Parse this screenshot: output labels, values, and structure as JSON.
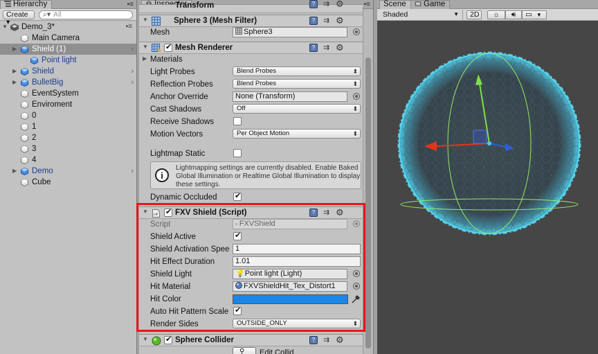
{
  "hierarchy": {
    "tab_label": "Hierarchy",
    "create_label": "Create",
    "search_placeholder": "All",
    "scene_name": "Demo_3*",
    "items": [
      {
        "label": "Main Camera",
        "style": "normal",
        "has_children": false,
        "selected": false
      },
      {
        "label": "Shield (1)",
        "style": "blue",
        "has_children": true,
        "selected": true
      },
      {
        "label": "Point light",
        "style": "blue",
        "has_children": false,
        "selected": false
      },
      {
        "label": "Shield",
        "style": "blue",
        "has_children": true,
        "selected": false
      },
      {
        "label": "BulletBig",
        "style": "blue",
        "has_children": true,
        "selected": false
      },
      {
        "label": "EventSystem",
        "style": "normal",
        "has_children": false,
        "selected": false
      },
      {
        "label": "Enviroment",
        "style": "normal",
        "has_children": false,
        "selected": false
      },
      {
        "label": "0",
        "style": "normal",
        "has_children": false,
        "selected": false
      },
      {
        "label": "1",
        "style": "normal",
        "has_children": false,
        "selected": false
      },
      {
        "label": "2",
        "style": "normal",
        "has_children": false,
        "selected": false
      },
      {
        "label": "3",
        "style": "normal",
        "has_children": false,
        "selected": false
      },
      {
        "label": "4",
        "style": "normal",
        "has_children": false,
        "selected": false
      },
      {
        "label": "Demo",
        "style": "blue",
        "has_children": true,
        "selected": false
      },
      {
        "label": "Cube",
        "style": "normal",
        "has_children": false,
        "selected": false
      }
    ]
  },
  "inspector": {
    "tab_label": "Inspector",
    "transform_label": "Transform",
    "mesh_filter": {
      "title": "Sphere 3 (Mesh Filter)",
      "mesh_label": "Mesh",
      "mesh_value": "Sphere3"
    },
    "mesh_renderer": {
      "title": "Mesh Renderer",
      "enabled": true,
      "materials_label": "Materials",
      "light_probes_label": "Light Probes",
      "light_probes_value": "Blend Probes",
      "reflection_probes_label": "Reflection Probes",
      "reflection_probes_value": "Blend Probes",
      "anchor_override_label": "Anchor Override",
      "anchor_override_value": "None (Transform)",
      "cast_shadows_label": "Cast Shadows",
      "cast_shadows_value": "Off",
      "receive_shadows_label": "Receive Shadows",
      "receive_shadows_checked": false,
      "motion_vectors_label": "Motion Vectors",
      "motion_vectors_value": "Per Object Motion",
      "lightmap_static_label": "Lightmap Static",
      "lightmap_static_checked": false,
      "help_text": "Lightmapping settings are currently disabled. Enable Baked Global Illumination or Realtime Global Illumination to display these settings.",
      "dynamic_occluded_label": "Dynamic Occluded",
      "dynamic_occluded_checked": true
    },
    "fxv_shield": {
      "title": "FXV Shield (Script)",
      "enabled": true,
      "script_label": "Script",
      "script_value": "FXVShield",
      "shield_active_label": "Shield Active",
      "shield_active_checked": true,
      "activation_speed_label": "Shield Activation Spee",
      "activation_speed_value": "1",
      "hit_duration_label": "Hit Effect Duration",
      "hit_duration_value": "1.01",
      "shield_light_label": "Shield Light",
      "shield_light_value": "Point light (Light)",
      "hit_material_label": "Hit Material",
      "hit_material_value": "FXVShieldHit_Tex_Distort1",
      "hit_color_label": "Hit Color",
      "hit_color": "#1a86e8",
      "auto_hit_label": "Auto Hit Pattern Scale",
      "auto_hit_checked": true,
      "render_sides_label": "Render Sides",
      "render_sides_value": "OUTSIDE_ONLY"
    },
    "sphere_collider": {
      "title": "Sphere Collider",
      "enabled": true,
      "edit_label": "Edit Collid"
    }
  },
  "scene": {
    "tab_scene": "Scene",
    "tab_game": "Game",
    "shading_mode": "Shaded",
    "mode_2d": "2D"
  },
  "colors": {
    "highlight_border": "#e8161b",
    "hit_color": "#1a86e8",
    "shield_glow": "#4fd2ee",
    "wire_green": "#9ae86a"
  }
}
